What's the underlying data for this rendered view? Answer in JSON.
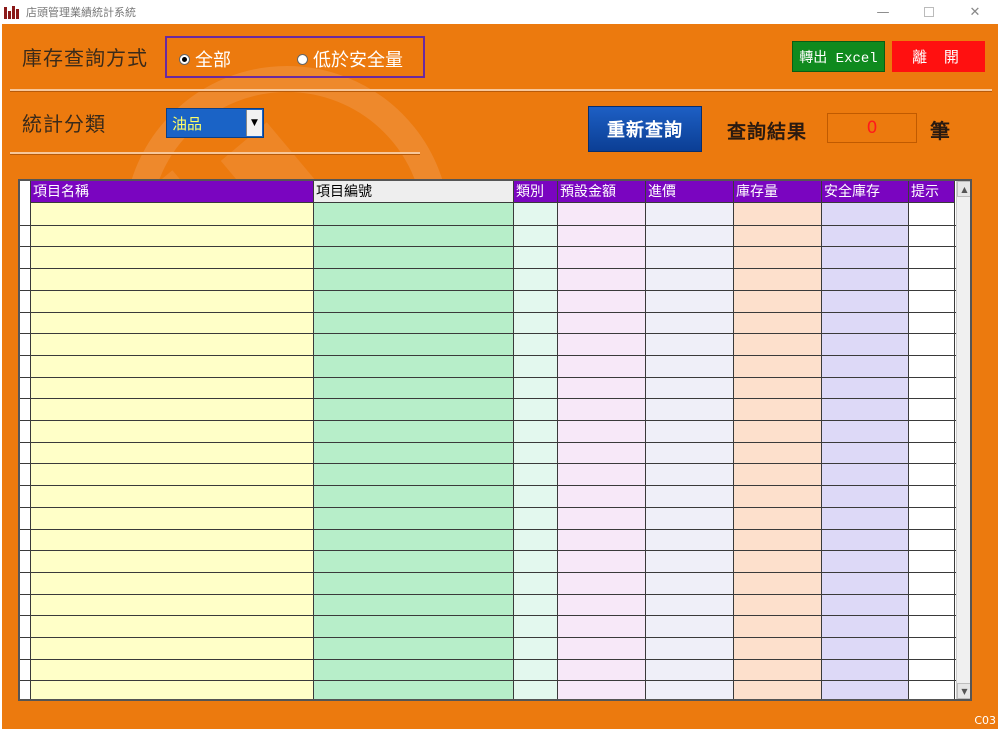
{
  "window": {
    "title": "店頭管理業績統計系統",
    "min_glyph": "—",
    "close_glyph": "✕"
  },
  "query_mode": {
    "label": "庫存查詢方式",
    "options": [
      {
        "label": "全部",
        "selected": true
      },
      {
        "label": "低於安全量",
        "selected": false
      }
    ]
  },
  "toolbar": {
    "export_label": "轉出 Excel",
    "exit_label": "離 開",
    "requery_label": "重新查詢"
  },
  "category": {
    "label": "統計分類",
    "selected": "油品"
  },
  "result": {
    "label": "查詢結果",
    "count": "0",
    "unit": "筆"
  },
  "table": {
    "columns": [
      {
        "label": "項目名稱",
        "bg": "#ffffc8",
        "style": "purple"
      },
      {
        "label": "項目編號",
        "bg": "#b7eec9",
        "style": "light"
      },
      {
        "label": "類別",
        "bg": "#e3f8ee",
        "style": "purple"
      },
      {
        "label": "預設金額",
        "bg": "#f7e8f8",
        "style": "purple"
      },
      {
        "label": "進價",
        "bg": "#efeff8",
        "style": "purple"
      },
      {
        "label": "庫存量",
        "bg": "#fde0cc",
        "style": "purple"
      },
      {
        "label": "安全庫存",
        "bg": "#ddd9f7",
        "style": "purple"
      },
      {
        "label": "提示",
        "bg": "#ffffff",
        "style": "purple"
      }
    ],
    "empty_rows": 23
  },
  "footer": {
    "form_code": "C03"
  },
  "colors": {
    "form_bg": "#ec7a0e",
    "header_purple": "#7a05c0",
    "excel_green": "#0f8a1e",
    "exit_red": "#ff1010",
    "requery_blue": "#1d5fc4"
  },
  "icons": {
    "app": "bar-chart-icon",
    "dropdown": "chevron-down-icon",
    "scroll_up": "arrow-up-icon",
    "scroll_down": "arrow-down-icon"
  }
}
